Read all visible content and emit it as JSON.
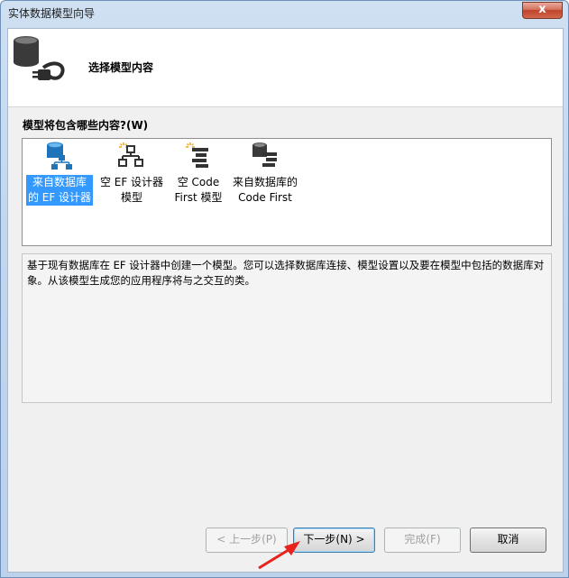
{
  "window": {
    "title": "实体数据模型向导",
    "close_glyph": "x"
  },
  "header": {
    "title": "选择模型内容",
    "icon": "database-plug-icon"
  },
  "question": {
    "label": "模型将包含哪些内容?(W)"
  },
  "model_options": [
    {
      "label": "来自数据库\n的 EF 设计器",
      "icon": "database-model-icon",
      "selected": true
    },
    {
      "label": "空 EF 设计器\n模型",
      "icon": "empty-designer-icon",
      "selected": false
    },
    {
      "label": "空 Code\nFirst 模型",
      "icon": "empty-code-first-icon",
      "selected": false
    },
    {
      "label": "来自数据库的\nCode First",
      "icon": "database-code-first-icon",
      "selected": false
    }
  ],
  "description": "基于现有数据库在 EF 设计器中创建一个模型。您可以选择数据库连接、模型设置以及要在模型中包括的数据库对象。从该模型生成您的应用程序将与之交互的类。",
  "buttons": {
    "back": "< 上一步(P)",
    "next": "下一步(N) >",
    "finish": "完成(F)",
    "cancel": "取消"
  },
  "colors": {
    "selection": "#3399ff",
    "annotation_arrow": "#e8221c"
  }
}
